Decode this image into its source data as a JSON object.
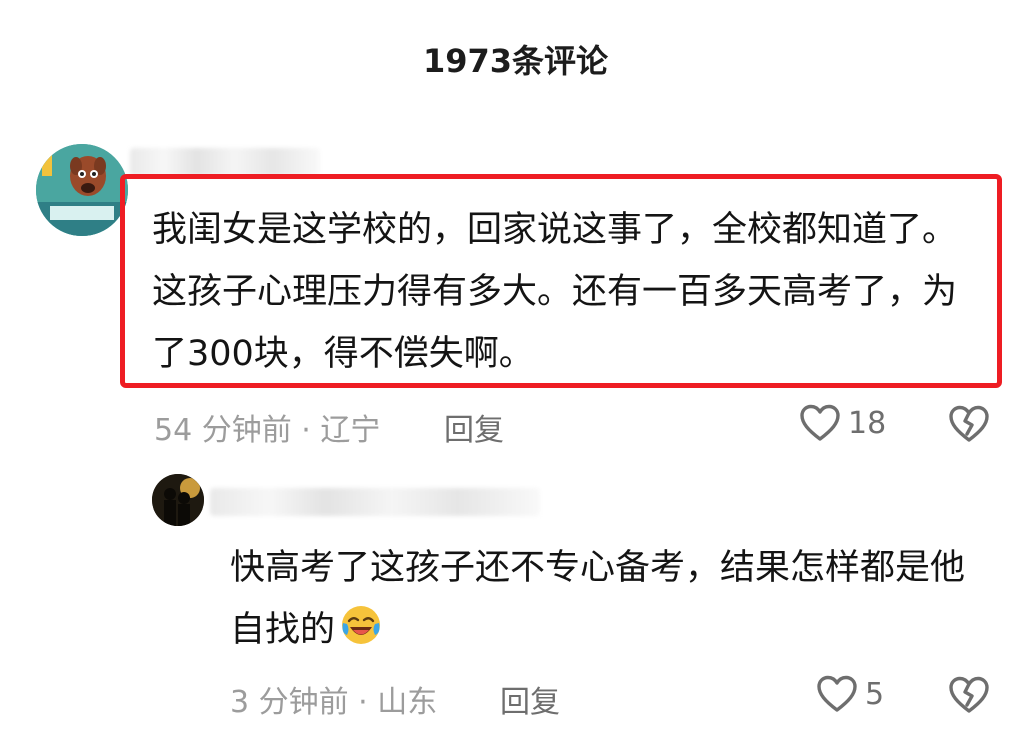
{
  "header": {
    "title": "1973条评论"
  },
  "comments": [
    {
      "text": "我闺女是这学校的，回家说这事了，全校都知道了。这孩子心理压力得有多大。还有一百多天高考了，为了300块，得不偿失啊。",
      "meta": "54 分钟前 · 辽宁",
      "reply_label": "回复",
      "likes": "18"
    },
    {
      "text": "快高考了这孩子还不专心备考，结果怎样都是他自找的",
      "meta": "3 分钟前 · 山东",
      "reply_label": "回复",
      "likes": "5"
    }
  ],
  "colors": {
    "highlight": "#ee1d23",
    "meta": "#9c9c9c",
    "action": "#6e6e6e"
  },
  "icons": [
    "heart-icon",
    "broken-heart-icon",
    "laughing-crying-emoji"
  ]
}
